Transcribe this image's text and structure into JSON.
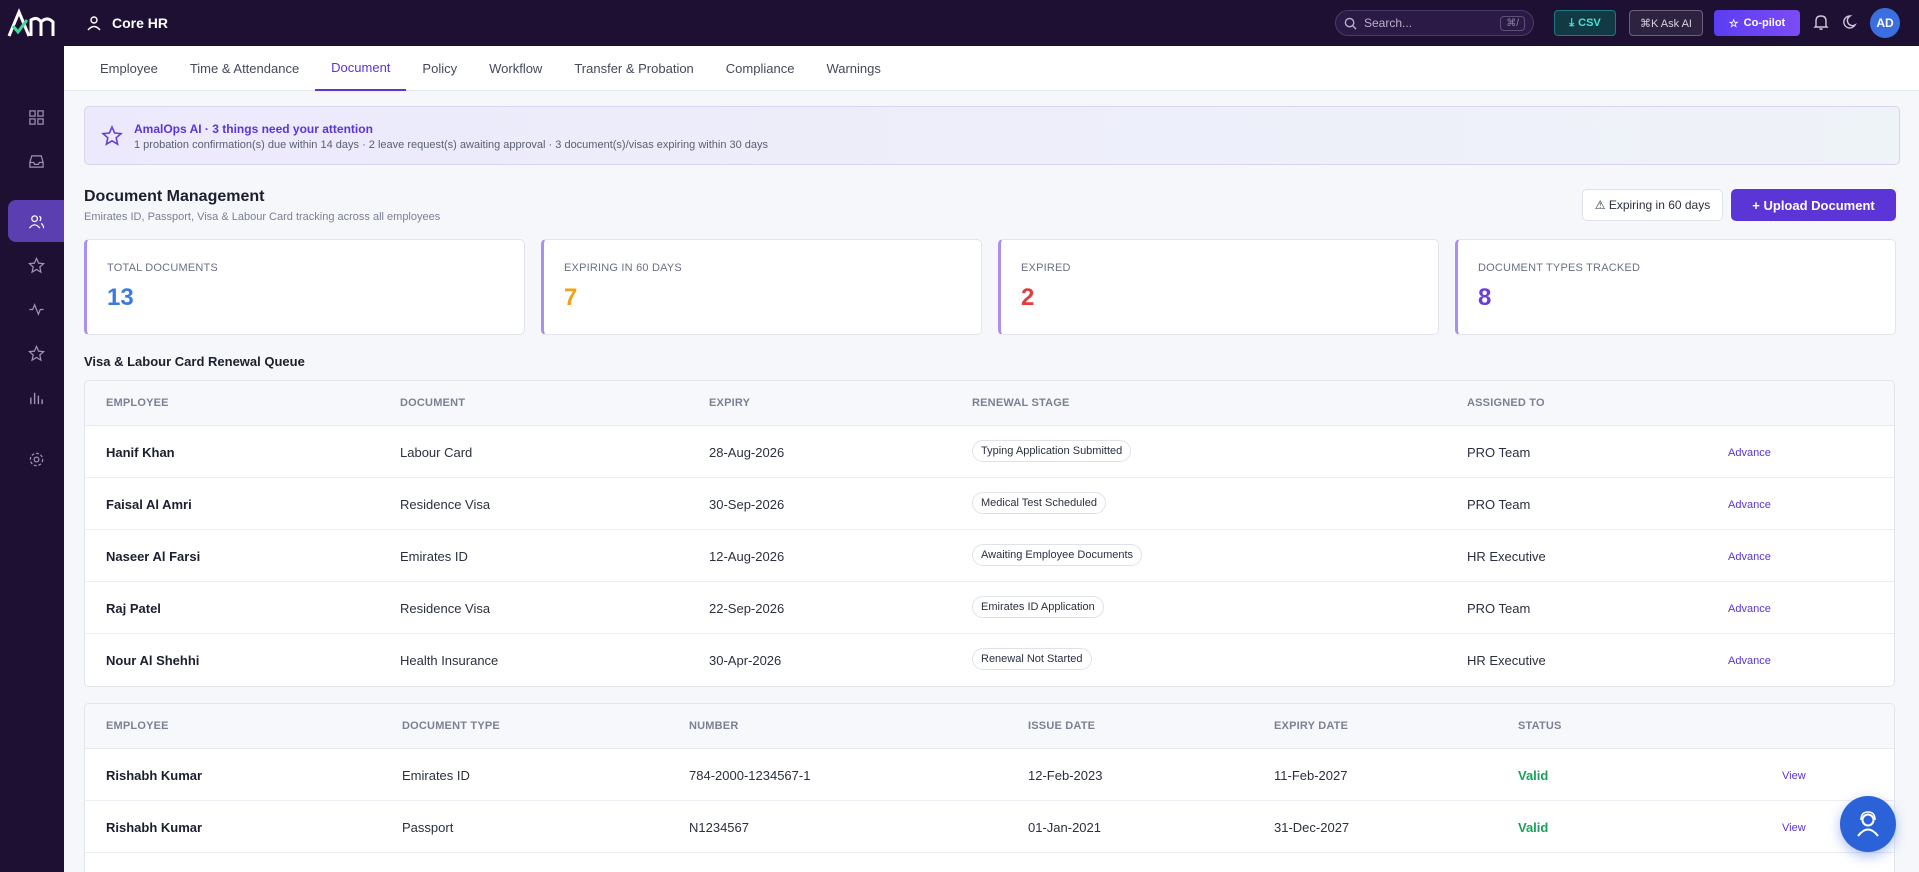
{
  "topbar": {
    "app_title": "Core HR",
    "search_placeholder": "Search...",
    "search_shortcut": "⌘/",
    "csv_label": "CSV",
    "ask_ai_label": "⌘K Ask AI",
    "copilot_label": "Co-pilot",
    "avatar_initials": "AD"
  },
  "sidebar": {
    "items": [
      {
        "icon": "grid-icon"
      },
      {
        "icon": "inbox-icon"
      },
      {
        "icon": "users-icon",
        "active": true
      },
      {
        "icon": "star-icon"
      },
      {
        "icon": "activity-icon"
      },
      {
        "icon": "star-icon"
      },
      {
        "icon": "bar-chart-icon"
      },
      {
        "icon": "settings-icon"
      }
    ]
  },
  "tabs": [
    {
      "label": "Employee"
    },
    {
      "label": "Time & Attendance"
    },
    {
      "label": "Document",
      "active": true
    },
    {
      "label": "Policy"
    },
    {
      "label": "Workflow"
    },
    {
      "label": "Transfer & Probation"
    },
    {
      "label": "Compliance"
    },
    {
      "label": "Warnings"
    }
  ],
  "ai_banner": {
    "title": "AmalOps AI · 3 things need your attention",
    "subtitle": "1 probation confirmation(s) due within 14 days · 2 leave request(s) awaiting approval · 3 document(s)/visas expiring within 30 days"
  },
  "header": {
    "title": "Document Management",
    "subtitle": "Emirates ID, Passport, Visa & Labour Card tracking across all employees",
    "expiring_button": "⚠ Expiring in 60 days",
    "upload_button": "+ Upload Document"
  },
  "stats": [
    {
      "label": "TOTAL DOCUMENTS",
      "value": "13",
      "color": "#3b7be0"
    },
    {
      "label": "EXPIRING IN 60 DAYS",
      "value": "7",
      "color": "#f2a114"
    },
    {
      "label": "EXPIRED",
      "value": "2",
      "color": "#e23c3c"
    },
    {
      "label": "DOCUMENT TYPES TRACKED",
      "value": "8",
      "color": "#6a3fd8"
    }
  ],
  "renewal": {
    "title": "Visa & Labour Card Renewal Queue",
    "headers": [
      "EMPLOYEE",
      "DOCUMENT",
      "EXPIRY",
      "RENEWAL STAGE",
      "ASSIGNED TO"
    ],
    "action_label": "Advance",
    "rows": [
      {
        "employee": "Hanif Khan",
        "document": "Labour Card",
        "expiry": "28-Aug-2026",
        "stage": "Typing Application Submitted",
        "assigned": "PRO Team"
      },
      {
        "employee": "Faisal Al Amri",
        "document": "Residence Visa",
        "expiry": "30-Sep-2026",
        "stage": "Medical Test Scheduled",
        "assigned": "PRO Team"
      },
      {
        "employee": "Naseer Al Farsi",
        "document": "Emirates ID",
        "expiry": "12-Aug-2026",
        "stage": "Awaiting Employee Documents",
        "assigned": "HR Executive"
      },
      {
        "employee": "Raj Patel",
        "document": "Residence Visa",
        "expiry": "22-Sep-2026",
        "stage": "Emirates ID Application",
        "assigned": "PRO Team"
      },
      {
        "employee": "Nour Al Shehhi",
        "document": "Health Insurance",
        "expiry": "30-Apr-2026",
        "stage": "Renewal Not Started",
        "assigned": "HR Executive"
      }
    ]
  },
  "documents": {
    "headers": [
      "EMPLOYEE",
      "DOCUMENT TYPE",
      "NUMBER",
      "ISSUE DATE",
      "EXPIRY DATE",
      "STATUS"
    ],
    "action_label": "View",
    "rows": [
      {
        "employee": "Rishabh Kumar",
        "type": "Emirates ID",
        "number": "784-2000-1234567-1",
        "issue": "12-Feb-2023",
        "expiry": "11-Feb-2027",
        "status": "Valid"
      },
      {
        "employee": "Rishabh Kumar",
        "type": "Passport",
        "number": "N1234567",
        "issue": "01-Jan-2021",
        "expiry": "31-Dec-2027",
        "status": "Valid"
      }
    ]
  }
}
